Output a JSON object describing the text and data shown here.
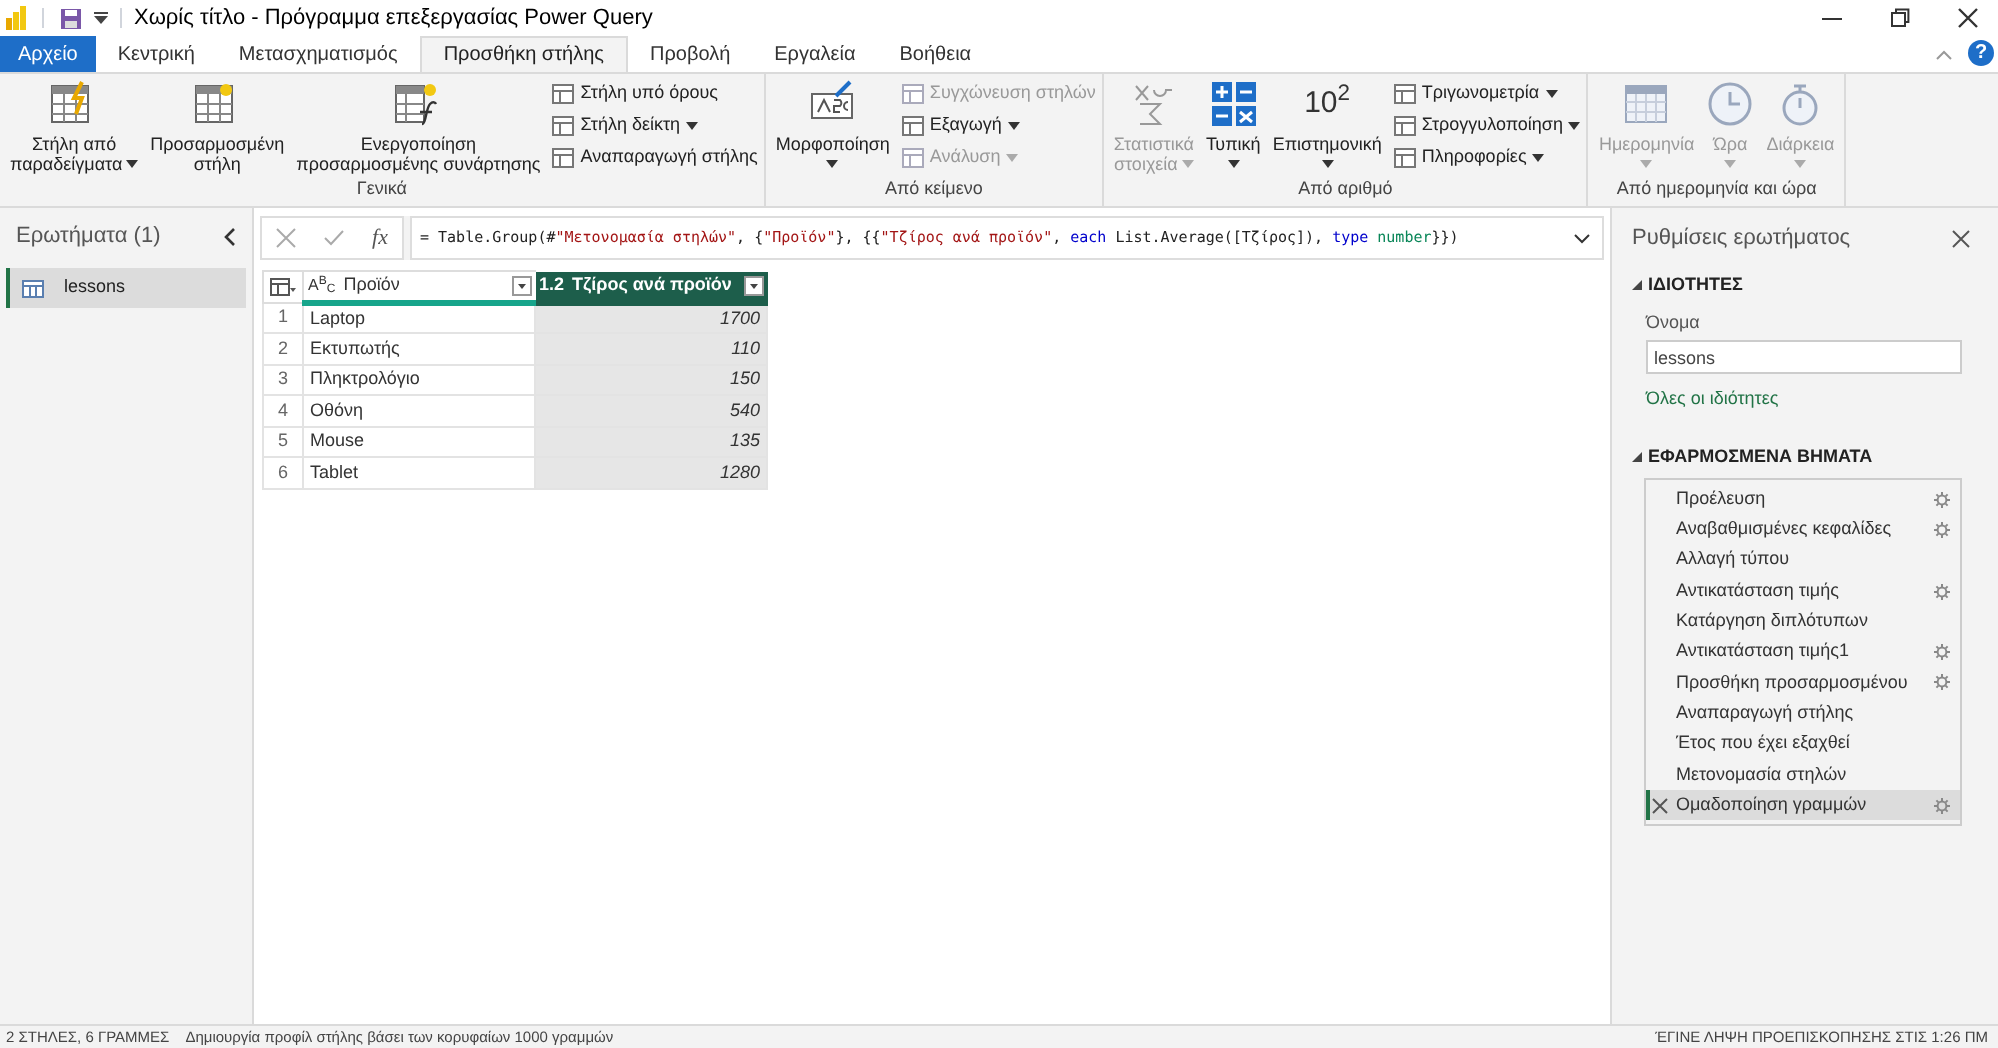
{
  "window": {
    "title": "Χωρίς τίτλο - Πρόγραμμα επεξεργασίας Power Query",
    "help": "?"
  },
  "tabs": [
    {
      "label": "Αρχείο",
      "kind": "file",
      "selected": false
    },
    {
      "label": "Κεντρική",
      "kind": "tab",
      "selected": false
    },
    {
      "label": "Μετασχηματισμός",
      "kind": "tab",
      "selected": false
    },
    {
      "label": "Προσθήκη στήλης",
      "kind": "tab",
      "selected": true
    },
    {
      "label": "Προβολή",
      "kind": "tab",
      "selected": false
    },
    {
      "label": "Εργαλεία",
      "kind": "tab",
      "selected": false
    },
    {
      "label": "Βοήθεια",
      "kind": "tab",
      "selected": false
    }
  ],
  "ribbon": {
    "groups": [
      {
        "label": "Γενικά",
        "items": [
          {
            "kind": "large",
            "lines": [
              "Στήλη από",
              "παραδείγματα"
            ],
            "dropdown": true,
            "disabled": false
          },
          {
            "kind": "large",
            "lines": [
              "Προσαρμοσμένη",
              "στήλη"
            ],
            "dropdown": false,
            "disabled": false
          },
          {
            "kind": "large",
            "lines": [
              "Ενεργοποίηση",
              "προσαρμοσμένης συνάρτησης"
            ],
            "dropdown": false,
            "disabled": false
          },
          {
            "kind": "stack",
            "children": [
              {
                "label": "Στήλη υπό όρους",
                "dropdown": false,
                "disabled": false
              },
              {
                "label": "Στήλη δείκτη",
                "dropdown": true,
                "disabled": false
              },
              {
                "label": "Αναπαραγωγή στήλης",
                "dropdown": false,
                "disabled": false
              }
            ]
          }
        ]
      },
      {
        "label": "Από κείμενο",
        "items": [
          {
            "kind": "large",
            "lines": [
              "Μορφοποίηση"
            ],
            "dropdown": true,
            "disabled": false
          },
          {
            "kind": "stack",
            "children": [
              {
                "label": "Συγχώνευση στηλών",
                "dropdown": false,
                "disabled": true
              },
              {
                "label": "Εξαγωγή",
                "dropdown": true,
                "disabled": false
              },
              {
                "label": "Ανάλυση",
                "dropdown": true,
                "disabled": true
              }
            ]
          }
        ]
      },
      {
        "label": "Από αριθμό",
        "items": [
          {
            "kind": "large",
            "lines": [
              "Στατιστικά",
              "στοιχεία"
            ],
            "dropdown": true,
            "disabled": true
          },
          {
            "kind": "large",
            "lines": [
              "Τυπική"
            ],
            "dropdown": true,
            "disabled": false
          },
          {
            "kind": "large",
            "glyph": "10$^{2}$",
            "lines": [
              "Επιστημονική"
            ],
            "dropdown": true,
            "disabled": false
          },
          {
            "kind": "stack",
            "children": [
              {
                "label": "Τριγωνομετρία",
                "dropdown": true,
                "disabled": false
              },
              {
                "label": "Στρογγυλοποίηση",
                "dropdown": true,
                "disabled": false
              },
              {
                "label": "Πληροφορίες",
                "dropdown": true,
                "disabled": false
              }
            ]
          }
        ]
      },
      {
        "label": "Από ημερομηνία και ώρα",
        "items": [
          {
            "kind": "large",
            "lines": [
              "Ημερομηνία"
            ],
            "dropdown": true,
            "disabled": true
          },
          {
            "kind": "large",
            "lines": [
              "Ώρα"
            ],
            "dropdown": true,
            "disabled": true
          },
          {
            "kind": "large",
            "lines": [
              "Διάρκεια"
            ],
            "dropdown": true,
            "disabled": true
          }
        ]
      }
    ]
  },
  "queries": {
    "title": "Ερωτήματα (1)",
    "items": [
      {
        "name": "lessons",
        "selected": true
      }
    ]
  },
  "formula": {
    "fx": "fx",
    "tokens": [
      {
        "kind": "plain",
        "text": "= Table.Group(#"
      },
      {
        "kind": "string",
        "text": "\"Μετονομασία στηλών\""
      },
      {
        "kind": "plain",
        "text": ", {"
      },
      {
        "kind": "string",
        "text": "\"Προϊόν\""
      },
      {
        "kind": "plain",
        "text": "}, {{"
      },
      {
        "kind": "string",
        "text": "\"Τζίρος ανά προϊόν\""
      },
      {
        "kind": "plain",
        "text": ", "
      },
      {
        "kind": "keyword",
        "text": "each"
      },
      {
        "kind": "plain",
        "text": " List.Average([Τζίρος]), "
      },
      {
        "kind": "keyword",
        "text": "type "
      },
      {
        "kind": "type",
        "text": "number"
      },
      {
        "kind": "plain",
        "text": "}})"
      }
    ]
  },
  "table": {
    "columns": [
      {
        "type": "A$^{B}$$_{C}$",
        "name": "Προϊόν",
        "kind": "text",
        "selected": false
      },
      {
        "type": "1.2",
        "name": "Τζίρος ανά προϊόν",
        "kind": "number",
        "selected": true
      }
    ],
    "rows": [
      {
        "index": "1",
        "cells": [
          "Laptop",
          "1700"
        ]
      },
      {
        "index": "2",
        "cells": [
          "Εκτυπωτής",
          "110"
        ]
      },
      {
        "index": "3",
        "cells": [
          "Πληκτρολόγιο",
          "150"
        ]
      },
      {
        "index": "4",
        "cells": [
          "Οθόνη",
          "540"
        ]
      },
      {
        "index": "5",
        "cells": [
          "Mouse",
          "135"
        ]
      },
      {
        "index": "6",
        "cells": [
          "Tablet",
          "1280"
        ]
      }
    ]
  },
  "settings": {
    "title": "Ρυθμίσεις ερωτήματος",
    "properties_heading": "ΙΔΙΟΤΗΤΕΣ",
    "name_label": "Όνομα",
    "name_value": "lessons",
    "all_properties": "Όλες οι ιδιότητες",
    "steps_heading": "ΕΦΑΡΜΟΣΜΕΝΑ ΒΗΜΑΤΑ",
    "steps": [
      {
        "name": "Προέλευση",
        "settings": true,
        "selected": false
      },
      {
        "name": "Αναβαθμισμένες κεφαλίδες",
        "settings": true,
        "selected": false
      },
      {
        "name": "Αλλαγή τύπου",
        "settings": false,
        "selected": false
      },
      {
        "name": "Αντικατάσταση τιμής",
        "settings": true,
        "selected": false
      },
      {
        "name": "Κατάργηση διπλότυπων",
        "settings": false,
        "selected": false
      },
      {
        "name": "Αντικατάσταση τιμής1",
        "settings": true,
        "selected": false
      },
      {
        "name": "Προσθήκη προσαρμοσμένου",
        "settings": true,
        "selected": false
      },
      {
        "name": "Αναπαραγωγή στήλης",
        "settings": false,
        "selected": false
      },
      {
        "name": "Έτος που έχει εξαχθεί",
        "settings": false,
        "selected": false
      },
      {
        "name": "Μετονομασία στηλών",
        "settings": false,
        "selected": false
      },
      {
        "name": "Ομαδοποίηση γραμμών",
        "settings": true,
        "selected": true
      }
    ]
  },
  "status_bar": {
    "left": [
      "2 ΣΤΗΛΕΣ, 6 ΓΡΑΜΜΕΣ",
      "Δημιουργία προφίλ στήλης βάσει των κορυφαίων 1000 γραμμών"
    ],
    "right": "ΈΓΙΝΕ ΛΗΨΗ ΠΡΟΕΠΙΣΚΟΠΗΣΗΣ ΣΤΙΣ 1:26 ΠΜ"
  }
}
